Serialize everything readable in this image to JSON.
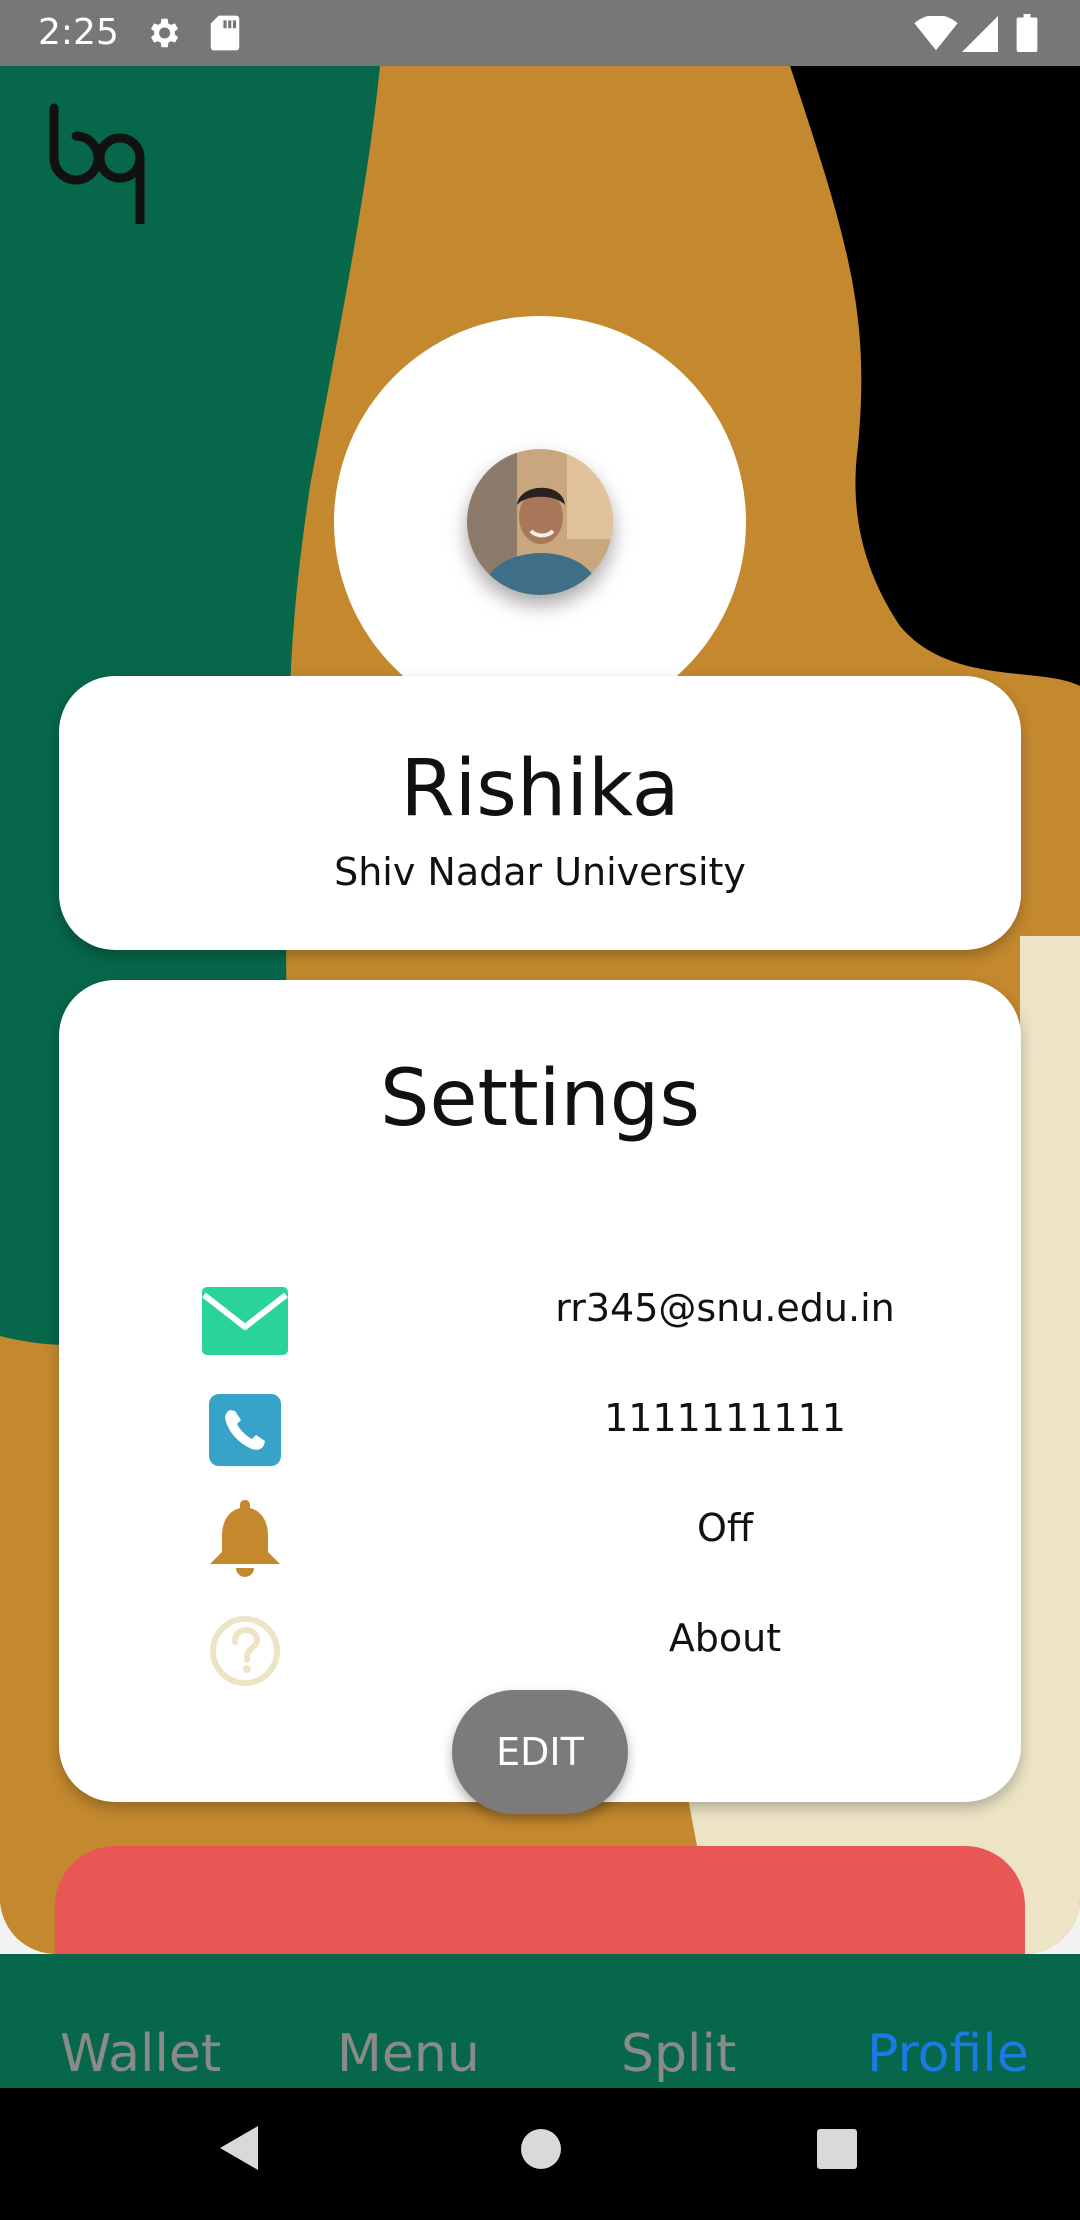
{
  "status_bar": {
    "time": "2:25",
    "icons": [
      "settings-icon",
      "sd-card-icon",
      "wifi-icon",
      "signal-icon",
      "battery-icon"
    ]
  },
  "profile": {
    "name": "Rishika",
    "university": "Shiv Nadar University"
  },
  "settings": {
    "title": "Settings",
    "rows": [
      {
        "icon": "mail-icon",
        "value": "rr345@snu.edu.in",
        "icon_color": "#2ad39b"
      },
      {
        "icon": "phone-icon",
        "value": "1111111111",
        "icon_color": "#38a3c9"
      },
      {
        "icon": "bell-icon",
        "value": "Off",
        "icon_color": "#c4892f"
      },
      {
        "icon": "help-icon",
        "value": "About",
        "icon_color": "#ede4c6"
      }
    ],
    "edit_label": "EDIT"
  },
  "bottom_nav": {
    "items": [
      {
        "label": "Wallet",
        "active": false
      },
      {
        "label": "Menu",
        "active": false
      },
      {
        "label": "Split",
        "active": false
      },
      {
        "label": "Profile",
        "active": true
      }
    ]
  },
  "colors": {
    "green": "#07674a",
    "ochre": "#c4892f",
    "cream": "#ede4c6",
    "red": "#e85656",
    "active_nav": "#1a7ae6"
  }
}
